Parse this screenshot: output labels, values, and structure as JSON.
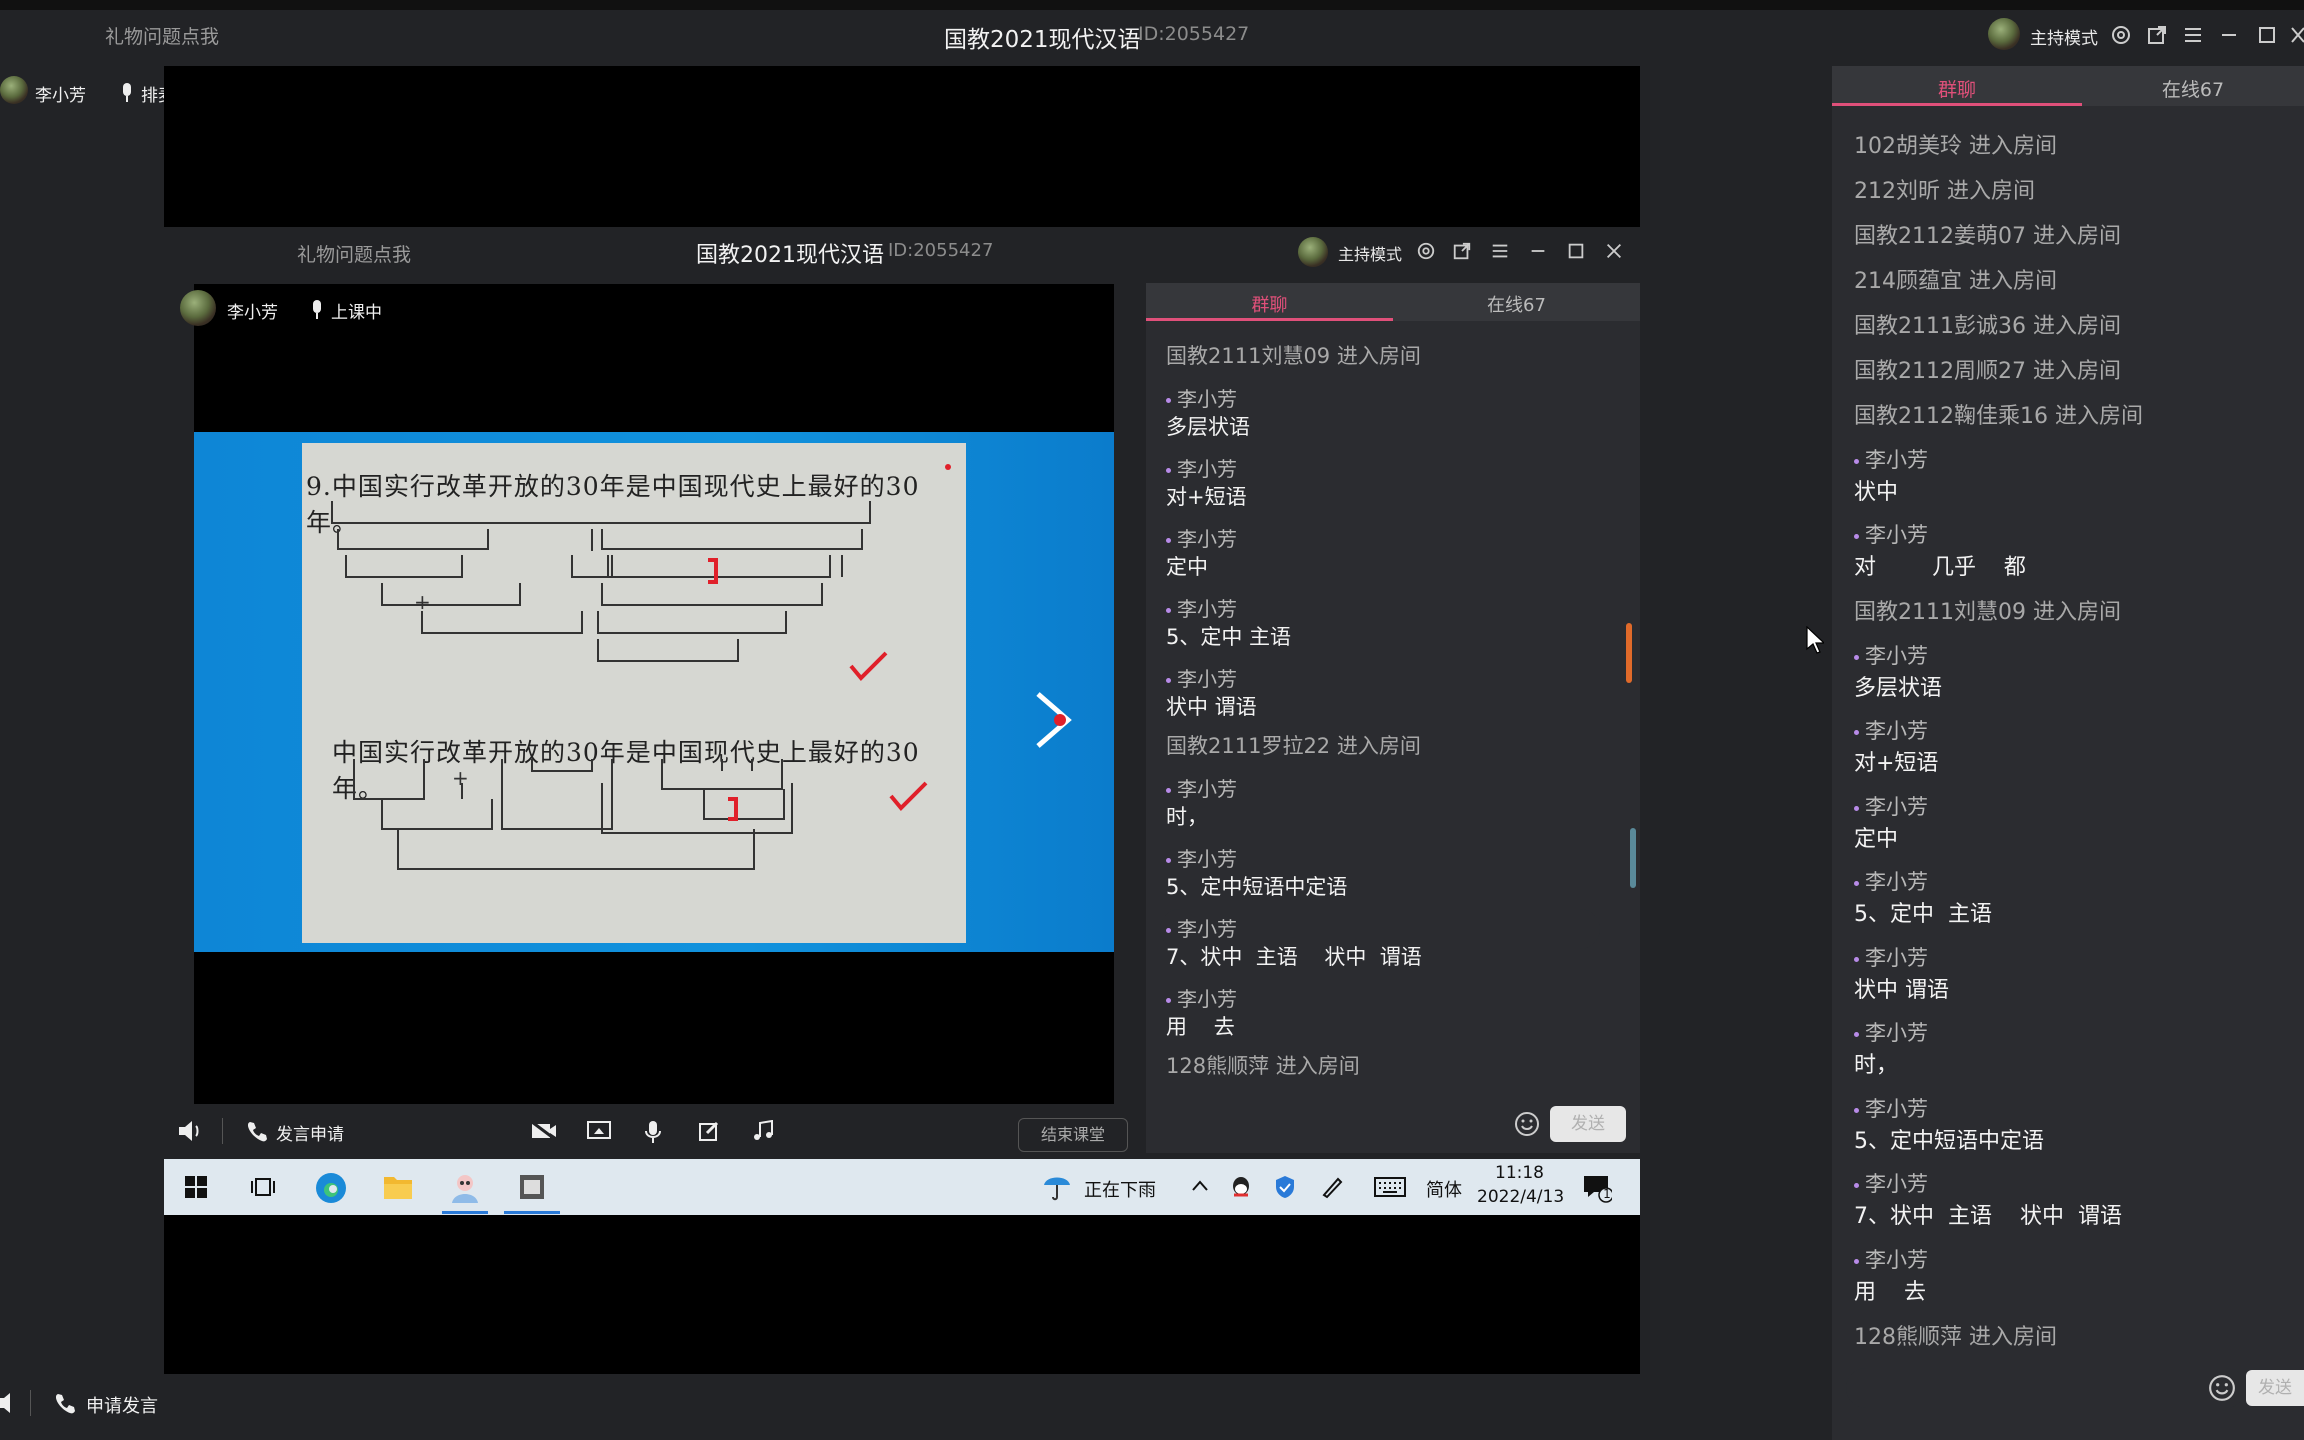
{
  "outer_window": {
    "gift_link": "礼物问题点我",
    "title": "国教2021现代汉语",
    "id_label": "ID:2055427",
    "host_mode": "主持模式",
    "speaker_name": "李小芳",
    "queue_label": "排麦",
    "apply_speak": "申请发言"
  },
  "inner_window": {
    "gift_link": "礼物问题点我",
    "title": "国教2021现代汉语",
    "id_label": "ID:2055427",
    "host_mode": "主持模式",
    "speaker_name": "李小芳",
    "status_label": "上课中",
    "apply_speak": "发言申请",
    "end_class": "结束课堂",
    "tabs": [
      {
        "label": "群聊",
        "active": true
      },
      {
        "label": "在线67",
        "active": false
      }
    ],
    "send_label": "发送",
    "messages": [
      {
        "type": "system",
        "text": "国教2111刘慧09 进入房间"
      },
      {
        "type": "user",
        "name": "李小芳",
        "text": "多层状语"
      },
      {
        "type": "user",
        "name": "李小芳",
        "text": "对+短语"
      },
      {
        "type": "user",
        "name": "李小芳",
        "text": "定中"
      },
      {
        "type": "user",
        "name": "李小芳",
        "text": "5、定中  主语"
      },
      {
        "type": "user",
        "name": "李小芳",
        "text": "状中 谓语"
      },
      {
        "type": "system",
        "text": "国教2111罗拉22 进入房间"
      },
      {
        "type": "user",
        "name": "李小芳",
        "text": "时，"
      },
      {
        "type": "user",
        "name": "李小芳",
        "text": "5、定中短语中定语"
      },
      {
        "type": "user",
        "name": "李小芳",
        "text": "7、状中  主语    状中  谓语"
      },
      {
        "type": "user",
        "name": "李小芳",
        "text": "用    去"
      },
      {
        "type": "system",
        "text": "128熊顺萍 进入房间"
      }
    ]
  },
  "slide": {
    "sentence_1": "9.中国实行改革开放的30年是中国现代史上最好的30年。",
    "sentence_2": "中国实行改革开放的30年是中国现代史上最好的30年。",
    "plus_mark": "+",
    "check_color": "#e0202a"
  },
  "taskbar": {
    "weather": "正在下雨",
    "ime": "简体",
    "time": "11:18",
    "date": "2022/4/13",
    "notifications": "1"
  },
  "outer_chat": {
    "tabs": [
      {
        "label": "群聊",
        "active": true
      },
      {
        "label": "在线67",
        "active": false
      }
    ],
    "send_label": "发送",
    "messages": [
      {
        "type": "system",
        "text": "102胡美玲 进入房间"
      },
      {
        "type": "system",
        "text": "212刘昕 进入房间"
      },
      {
        "type": "system",
        "text": "国教2112姜萌07 进入房间"
      },
      {
        "type": "system",
        "text": "214顾蕴宜 进入房间"
      },
      {
        "type": "system",
        "text": "国教2111彭诚36 进入房间"
      },
      {
        "type": "system",
        "text": "国教2112周顺27 进入房间"
      },
      {
        "type": "system",
        "text": "国教2112鞠佳乘16 进入房间"
      },
      {
        "type": "user",
        "name": "李小芳",
        "text": "状中"
      },
      {
        "type": "user",
        "name": "李小芳",
        "text": "对        几乎    都"
      },
      {
        "type": "system",
        "text": "国教2111刘慧09 进入房间"
      },
      {
        "type": "user",
        "name": "李小芳",
        "text": "多层状语"
      },
      {
        "type": "user",
        "name": "李小芳",
        "text": "对+短语"
      },
      {
        "type": "user",
        "name": "李小芳",
        "text": "定中"
      },
      {
        "type": "user",
        "name": "李小芳",
        "text": "5、定中  主语"
      },
      {
        "type": "user",
        "name": "李小芳",
        "text": "状中 谓语"
      },
      {
        "type": "user",
        "name": "李小芳",
        "text": "时，"
      },
      {
        "type": "user",
        "name": "李小芳",
        "text": "5、定中短语中定语"
      },
      {
        "type": "user",
        "name": "李小芳",
        "text": "7、状中  主语    状中  谓语"
      },
      {
        "type": "user",
        "name": "李小芳",
        "text": "用    去"
      },
      {
        "type": "system",
        "text": "128熊顺萍 进入房间"
      }
    ]
  },
  "colors": {
    "accent_pink": "#e0507a",
    "bg_dark": "#222326",
    "chat_bg": "#2b2c30"
  }
}
